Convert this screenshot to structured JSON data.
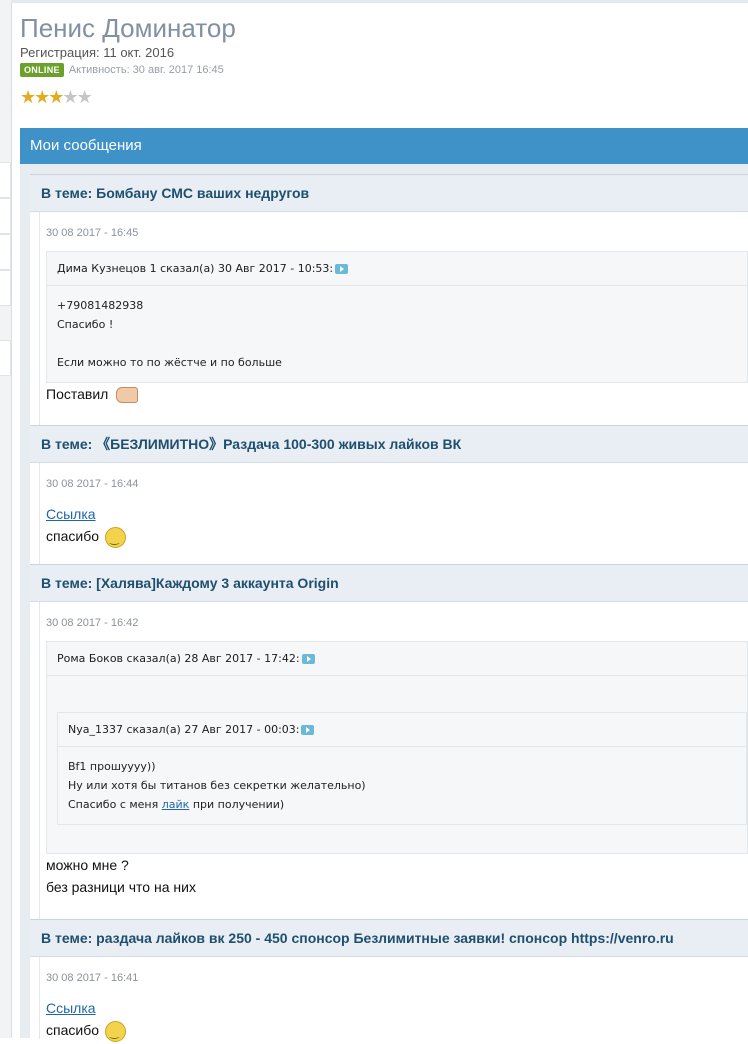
{
  "profile": {
    "name": "Пенис Доминатор",
    "registration": "Регистрация: 11 окт. 2016",
    "online_badge": "ONLINE",
    "activity": "Активность: 30 авг. 2017 16:45",
    "rating": 3,
    "rating_max": 5
  },
  "section_title": "Мои сообщения",
  "posts": [
    {
      "title": "В теме: Бомбану СМС ваших недругов",
      "date": "30 08 2017 - 16:45",
      "quote": {
        "header": "Дима Кузнецов 1 сказал(а) 30 Авг 2017 - 10:53:",
        "lines": [
          "+79081482938",
          "Спасибо !",
          "",
          "Если можно то по жёстче и по больше"
        ]
      },
      "text": "Поставил"
    },
    {
      "title": "В теме: 《БЕЗЛИМИТНО》Раздача 100-300 живых лайков ВК",
      "date": "30 08 2017 - 16:44",
      "link": "Ссылка",
      "text": "спасибо"
    },
    {
      "title": "В теме: [Халява]Каждому 3 аккаунта Origin",
      "date": "30 08 2017 - 16:42",
      "quote": {
        "header": "Рома Боков сказал(а) 28 Авг 2017 - 17:42:",
        "nested": {
          "header": "Nya_1337 сказал(а) 27 Авг 2017 - 00:03:",
          "line1": "Bf1 прошуууу))",
          "line2": "Ну или хотя бы титанов без секретки желательно)",
          "line3_before": "Спасибо с меня",
          "line3_link": "лайк",
          "line3_after": "при получении)"
        }
      },
      "text_lines": [
        "можно мне ?",
        "без разници что на них"
      ]
    },
    {
      "title": "В теме: раздача лайков вк 250 - 450 спонсор Безлимитные заявки! спонсор https://venro.ru",
      "date": "30 08 2017 - 16:41",
      "link": "Ссылка",
      "text": "спасибо"
    }
  ]
}
